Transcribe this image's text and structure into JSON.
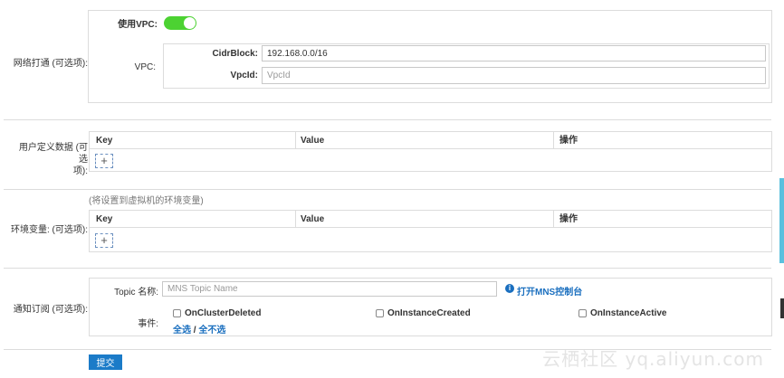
{
  "network": {
    "row_label": "网络打通 (可选项):",
    "use_vpc_label": "使用VPC:",
    "use_vpc_enabled": true,
    "vpc_label": "VPC:",
    "cidr_label": "CidrBlock:",
    "cidr_value": "192.168.0.0/16",
    "vpcid_label": "VpcId:",
    "vpcid_placeholder": "VpcId"
  },
  "user_data": {
    "row_label_line1": "用户定义数据 (可选",
    "row_label_line2": "项):",
    "col_key": "Key",
    "col_value": "Value",
    "col_action": "操作",
    "add_icon": "+"
  },
  "env_vars": {
    "hint": "(将设置到虚拟机的环境变量)",
    "row_label": "环境变量: (可选项):",
    "col_key": "Key",
    "col_value": "Value",
    "col_action": "操作",
    "add_icon": "+"
  },
  "notification": {
    "row_label": "通知订阅 (可选项):",
    "topic_label": "Topic 名称:",
    "topic_placeholder": "MNS Topic Name",
    "mns_link": "打开MNS控制台",
    "info_icon": "i",
    "events_label": "事件:",
    "events": [
      {
        "label": "OnClusterDeleted",
        "checked": false
      },
      {
        "label": "OnInstanceCreated",
        "checked": false
      },
      {
        "label": "OnInstanceActive",
        "checked": false
      }
    ],
    "select_all": "全选",
    "separator": " / ",
    "select_none": "全不选"
  },
  "submit_label": "提交",
  "watermark": "云栖社区 yq.aliyun.com",
  "colors": {
    "toggle_on": "#4cd232",
    "link": "#1a6fbf",
    "submit_bg": "#1b7bc8",
    "side_tab": "#5bc0de"
  }
}
